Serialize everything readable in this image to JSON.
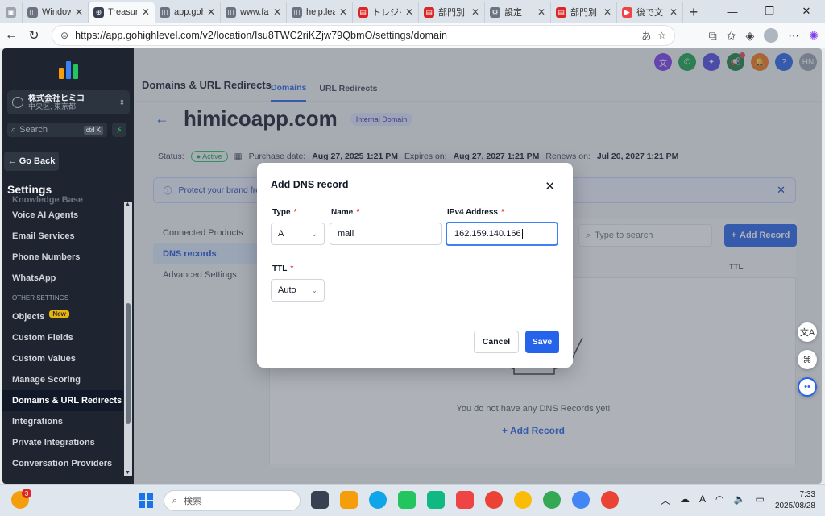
{
  "browser": {
    "tabs": [
      {
        "label": "",
        "icon": "window-icon",
        "color": "#9ca3af"
      },
      {
        "label": "Window",
        "icon": "page-icon",
        "color": "#6b7280"
      },
      {
        "label": "Treasure",
        "icon": "globe-icon",
        "color": "#374151",
        "active": true
      },
      {
        "label": "app.goh",
        "icon": "page-icon",
        "color": "#6b7280"
      },
      {
        "label": "www.fa",
        "icon": "page-icon",
        "color": "#6b7280"
      },
      {
        "label": "help.lea",
        "icon": "page-icon",
        "color": "#6b7280"
      },
      {
        "label": "トレジャ",
        "icon": "pdf-icon",
        "color": "#dc2626"
      },
      {
        "label": "部門別",
        "icon": "pdf-icon",
        "color": "#dc2626"
      },
      {
        "label": "設定",
        "icon": "gear-icon",
        "color": "#6b7280"
      },
      {
        "label": "部門別",
        "icon": "pdf-icon",
        "color": "#dc2626"
      },
      {
        "label": "後で文",
        "icon": "youtube-icon",
        "color": "#ef4444"
      }
    ],
    "url": "https://app.gohighlevel.com/v2/location/Isu8TWC2riKZjw79QbmO/settings/domain"
  },
  "sidebar": {
    "account_name": "株式会社ヒミコ",
    "account_location": "中央区, 東京都",
    "search_placeholder": "Search",
    "search_shortcut": "ctrl K",
    "go_back": "Go Back",
    "settings_title": "Settings",
    "items": [
      {
        "label": "Knowledge Base",
        "faded": true
      },
      {
        "label": "Voice AI Agents"
      },
      {
        "label": "Email Services"
      },
      {
        "label": "Phone Numbers"
      },
      {
        "label": "WhatsApp"
      },
      {
        "section": "OTHER SETTINGS"
      },
      {
        "label": "Objects",
        "badge": "New"
      },
      {
        "label": "Custom Fields"
      },
      {
        "label": "Custom Values"
      },
      {
        "label": "Manage Scoring"
      },
      {
        "label": "Domains & URL Redirects",
        "active": true
      },
      {
        "label": "Integrations"
      },
      {
        "label": "Private Integrations"
      },
      {
        "label": "Conversation Providers"
      }
    ]
  },
  "topbar": {
    "icons": [
      {
        "name": "translate-icon",
        "glyph": "文",
        "color": "#7c3aed"
      },
      {
        "name": "phone-icon",
        "glyph": "✆",
        "color": "#16a34a"
      },
      {
        "name": "magic-icon",
        "glyph": "✦",
        "color": "#4f46e5"
      },
      {
        "name": "megaphone-icon",
        "glyph": "📢",
        "color": "#15803d",
        "dot": true
      },
      {
        "name": "bell-icon",
        "glyph": "🔔",
        "color": "#f97316"
      },
      {
        "name": "help-icon",
        "glyph": "?",
        "color": "#2563eb"
      },
      {
        "name": "user-avatar",
        "glyph": "HN",
        "color": "#9ca3af"
      }
    ]
  },
  "page": {
    "heading": "Domains & URL Redirects",
    "tab_domains": "Domains",
    "tab_redirects": "URL Redirects",
    "domain": "himicoapp.com",
    "domain_tag": "Internal Domain",
    "status_label": "Status:",
    "status_value": "Active",
    "purchase_label": "Purchase date:",
    "purchase_value": "Aug 27, 2025 1:21 PM",
    "expires_label": "Expires on:",
    "expires_value": "Aug 27, 2027 1:21 PM",
    "renews_label": "Renews on:",
    "renews_value": "Jul 20, 2027 1:21 PM",
    "banner": "Protect your brand fro",
    "subnav": [
      "Connected Products",
      "DNS records",
      "Advanced Settings"
    ],
    "table_search_placeholder": "Type to search",
    "add_record_button": "Add Record",
    "col_ttl": "TTL",
    "empty_text": "You do not have any DNS Records yet!",
    "add_record_link": "Add Record"
  },
  "modal": {
    "title": "Add DNS record",
    "type_label": "Type",
    "type_value": "A",
    "name_label": "Name",
    "name_value": "mail",
    "ip_label": "IPv4 Address",
    "ip_value": "162.159.140.166",
    "ttl_label": "TTL",
    "ttl_value": "Auto",
    "cancel": "Cancel",
    "save": "Save",
    "required_mark": "*"
  },
  "taskbar": {
    "weather_badge": "3",
    "search_placeholder": "検索",
    "time": "7:33",
    "date": "2025/08/28",
    "ime": "A"
  }
}
